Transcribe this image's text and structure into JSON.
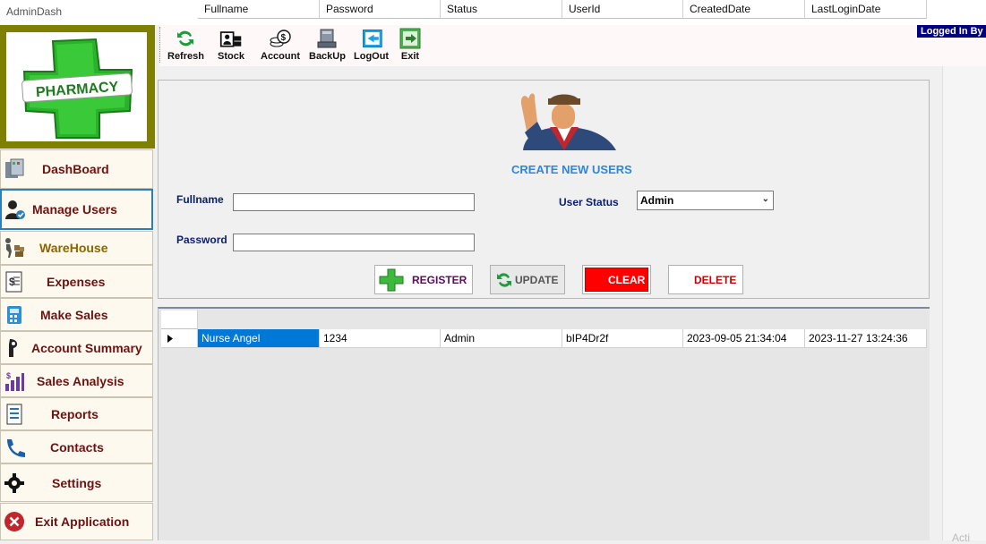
{
  "window": {
    "title": "AdminDash"
  },
  "logo": {
    "text": "PHARMACY"
  },
  "toolbar": {
    "items": [
      {
        "label": "Refresh",
        "icon": "refresh-icon"
      },
      {
        "label": "Stock",
        "icon": "stock-icon"
      },
      {
        "label": "Account",
        "icon": "account-icon"
      },
      {
        "label": "BackUp",
        "icon": "backup-icon"
      },
      {
        "label": "LogOut",
        "icon": "logout-icon"
      },
      {
        "label": "Exit",
        "icon": "exit-icon"
      }
    ],
    "logged_in": "Logged In By"
  },
  "sidebar": {
    "items": [
      {
        "label": "DashBoard",
        "icon": "dashboard-icon"
      },
      {
        "label": "Manage Users",
        "icon": "users-icon",
        "active": true
      },
      {
        "label": "WareHouse",
        "icon": "warehouse-icon"
      },
      {
        "label": "Expenses",
        "icon": "expenses-icon"
      },
      {
        "label": "Make Sales",
        "icon": "sales-icon"
      },
      {
        "label": "Account Summary",
        "icon": "account-summary-icon"
      },
      {
        "label": "Sales Analysis",
        "icon": "analysis-icon"
      },
      {
        "label": "Reports",
        "icon": "reports-icon"
      },
      {
        "label": "Contacts",
        "icon": "phone-icon"
      },
      {
        "label": "Settings",
        "icon": "gear-icon"
      },
      {
        "label": "Exit Application",
        "icon": "close-icon"
      }
    ]
  },
  "form": {
    "title": "CREATE NEW USERS",
    "fullname_label": "Fullname",
    "fullname_value": "",
    "password_label": "Password",
    "password_value": "",
    "status_label": "User Status",
    "status_value": "Admin",
    "buttons": {
      "register": "REGISTER",
      "update": "UPDATE",
      "clear": "CLEAR",
      "delete": "DELETE"
    }
  },
  "grid": {
    "columns": [
      "Fullname",
      "Password",
      "Status",
      "UserId",
      "CreatedDate",
      "LastLoginDate"
    ],
    "rows": [
      [
        "Nurse Angel",
        "1234",
        "Admin",
        "bIP4Dr2f",
        "2023-09-05 21:34:04",
        "2023-11-27 13:24:36"
      ]
    ]
  },
  "colors": {
    "logo_frame": "#808000",
    "nav_text": "#6b1313",
    "title_accent": "#2e86de",
    "selected_cell": "#0078d7",
    "clear_button": "#ff0000",
    "delete_text": "#cc0000"
  },
  "watermark": "Acti"
}
